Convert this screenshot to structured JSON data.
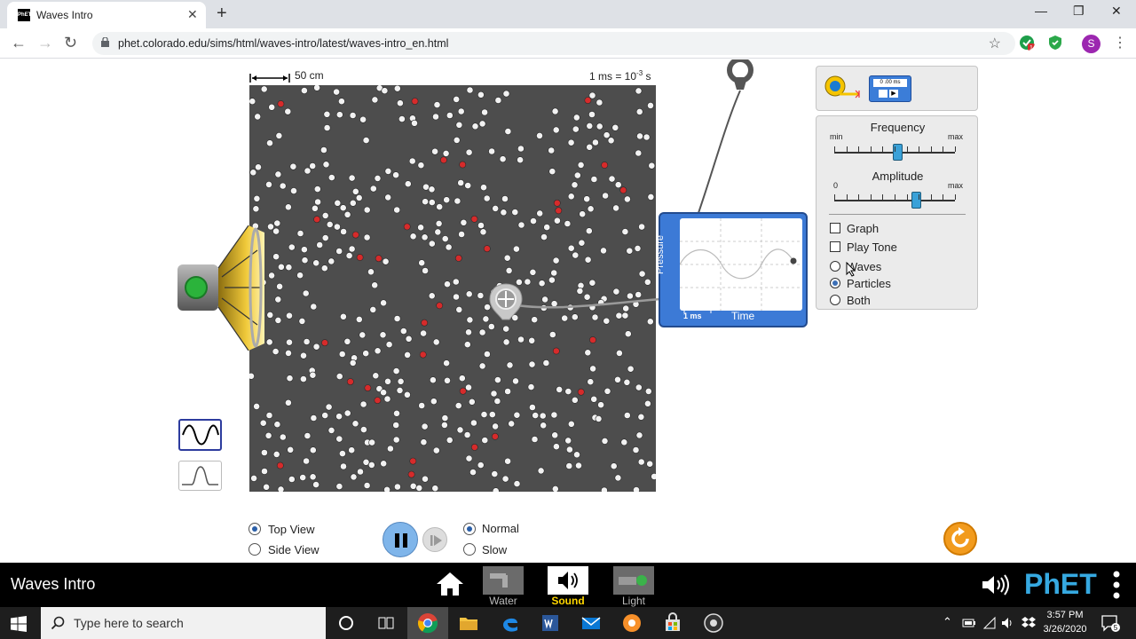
{
  "browser": {
    "tab_title": "Waves Intro",
    "favicon_text": "PhET",
    "url": "phet.colorado.edu/sims/html/waves-intro/latest/waves-intro_en.html",
    "extension_badge": "1",
    "profile_initial": "S"
  },
  "sim": {
    "scale_label": "50 cm",
    "time_label": "1 ms = 10",
    "time_exponent": "-3",
    "time_unit": " s",
    "toolbox": {
      "stopwatch_readout": "0 .00 ms"
    },
    "controls": {
      "frequency_title": "Frequency",
      "frequency_min": "min",
      "frequency_max": "max",
      "frequency_level": 0.52,
      "amplitude_title": "Amplitude",
      "amplitude_min": "0",
      "amplitude_max": "max",
      "amplitude_level": 0.68,
      "checkboxes": [
        {
          "label": "Graph",
          "checked": false
        },
        {
          "label": "Play Tone",
          "checked": false
        }
      ],
      "radios": [
        {
          "label": "Waves",
          "selected": false
        },
        {
          "label": "Particles",
          "selected": true
        },
        {
          "label": "Both",
          "selected": false
        }
      ]
    },
    "scope": {
      "y_label": "Pressure",
      "x_label": "Time",
      "scale": "1 ms"
    },
    "view_options": [
      {
        "label": "Top View",
        "selected": true
      },
      {
        "label": "Side View",
        "selected": false
      }
    ],
    "speed_options": [
      {
        "label": "Normal",
        "selected": true
      },
      {
        "label": "Slow",
        "selected": false
      }
    ]
  },
  "navbar": {
    "title": "Waves Intro",
    "screens": [
      {
        "label": "Water",
        "active": false
      },
      {
        "label": "Sound",
        "active": true
      },
      {
        "label": "Light",
        "active": false
      }
    ],
    "logo": "PhET"
  },
  "taskbar": {
    "search_placeholder": "Type here to search",
    "time": "3:57 PM",
    "date": "3/26/2020",
    "notification_count": "5"
  },
  "colors": {
    "field_bg": "#4d4d4d",
    "particle": "#f2f2f2",
    "particle_marked": "#d62b2b",
    "scope_blue": "#3c7ad6",
    "slider_thumb": "#3aa1d8",
    "reset_orange": "#f29b1d",
    "sound_label": "#ffd700"
  }
}
